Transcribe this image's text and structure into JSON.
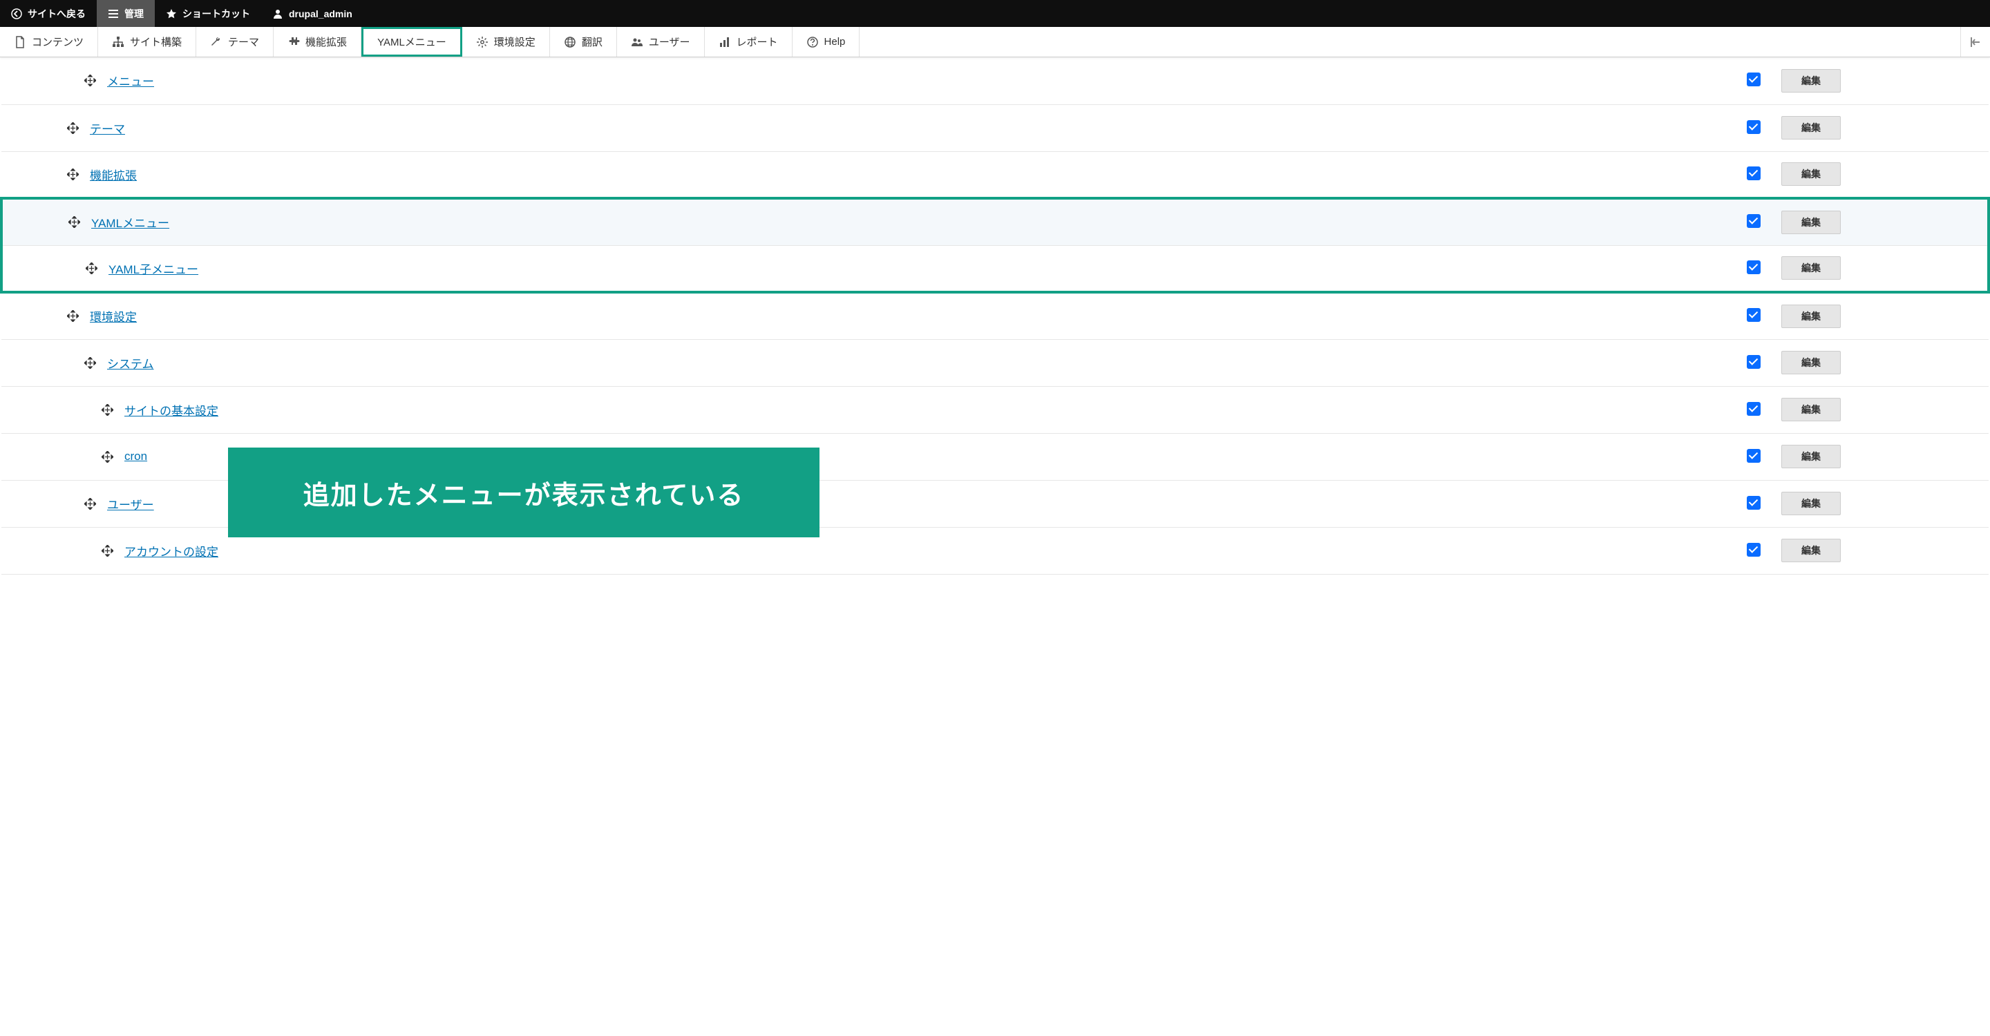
{
  "toolbar": {
    "back": "サイトへ戻る",
    "manage": "管理",
    "shortcuts": "ショートカット",
    "user": "drupal_admin"
  },
  "nav": {
    "content": "コンテンツ",
    "structure": "サイト構築",
    "theme": "テーマ",
    "extend": "機能拡張",
    "yaml_menu": "YAMLメニュー",
    "config": "環境設定",
    "translate": "翻訳",
    "people": "ユーザー",
    "reports": "レポート",
    "help": "Help"
  },
  "edit_label": "編集",
  "rows": [
    {
      "label": "メニュー",
      "indent": 2,
      "checked": true
    },
    {
      "label": "テーマ",
      "indent": 1,
      "checked": true
    },
    {
      "label": "機能拡張",
      "indent": 1,
      "checked": true
    },
    {
      "label": "YAMLメニュー",
      "indent": 1,
      "checked": true,
      "hl": "top"
    },
    {
      "label": "YAML子メニュー",
      "indent": 2,
      "checked": true,
      "hl": "bot"
    },
    {
      "label": "環境設定",
      "indent": 1,
      "checked": true
    },
    {
      "label": "システム",
      "indent": 2,
      "checked": true
    },
    {
      "label": "サイトの基本設定",
      "indent": 3,
      "checked": true
    },
    {
      "label": "cron",
      "indent": 3,
      "checked": true
    },
    {
      "label": "ユーザー",
      "indent": 2,
      "checked": true
    },
    {
      "label": "アカウントの設定",
      "indent": 3,
      "checked": true
    }
  ],
  "annotation": "追加したメニューが表示されている"
}
